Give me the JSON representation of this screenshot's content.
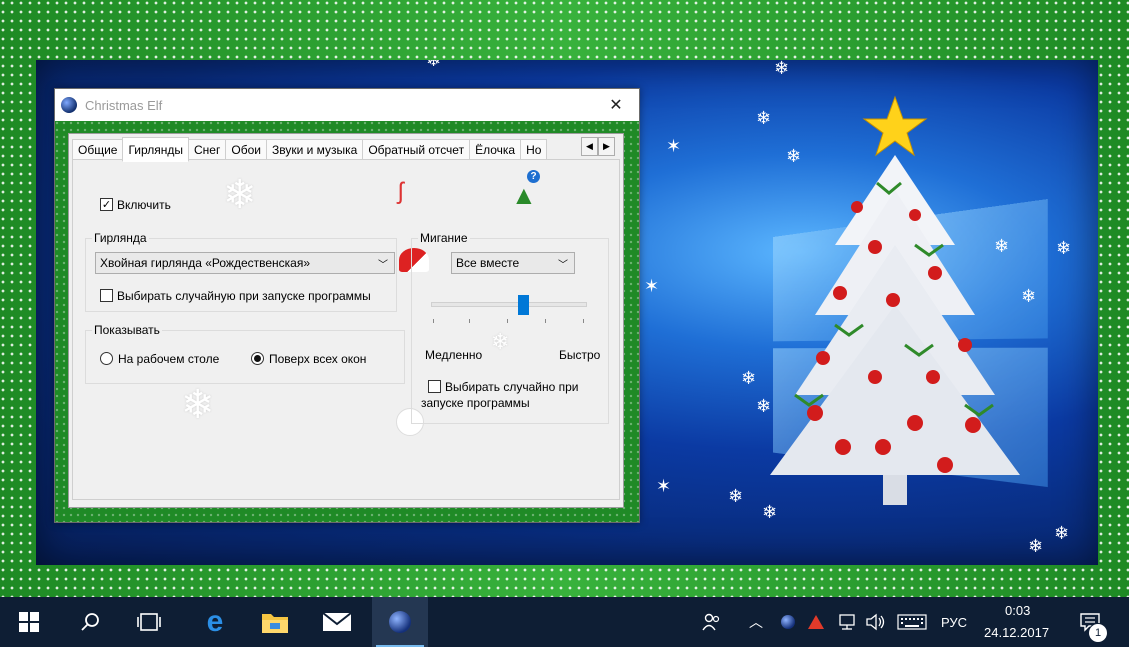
{
  "window": {
    "title": "Christmas Elf",
    "close_glyph": "✕"
  },
  "tabs": [
    {
      "label": "Общие",
      "active": false
    },
    {
      "label": "Гирлянды",
      "active": true
    },
    {
      "label": "Снег",
      "active": false
    },
    {
      "label": "Обои",
      "active": false
    },
    {
      "label": "Звуки и музыка",
      "active": false
    },
    {
      "label": "Обратный отсчет",
      "active": false
    },
    {
      "label": "Ёлочка",
      "active": false
    },
    {
      "label": "Но",
      "active": false
    }
  ],
  "tab_scroll": {
    "left": "◀",
    "right": "▶"
  },
  "help_glyph": "?",
  "garlands": {
    "enable_label": "Включить",
    "enable_checked": true,
    "garland_group_label": "Гирлянда",
    "garland_selected": "Хвойная гирлянда «Рождественская»",
    "garland_random_label": "Выбирать случайную при запуске программы",
    "garland_random_checked": false,
    "show_group_label": "Показывать",
    "show_desktop_label": "На рабочем столе",
    "show_top_label": "Поверх всех окон",
    "show_selected": "top",
    "blink_group_label": "Мигание",
    "blink_selected": "Все вместе",
    "blink_speed_fraction": 0.6,
    "slow_label": "Медленно",
    "fast_label": "Быстро",
    "blink_random_label_1": "Выбирать случайно при",
    "blink_random_label_2": "запуске программы",
    "blink_random_checked": false
  },
  "taskbar": {
    "language": "РУС",
    "time": "0:03",
    "date": "24.12.2017",
    "notification_count": "1"
  },
  "colors": {
    "taskbar_bg": "#0e1e34",
    "accent": "#0078d7",
    "garland_green": "#1f8a26"
  }
}
